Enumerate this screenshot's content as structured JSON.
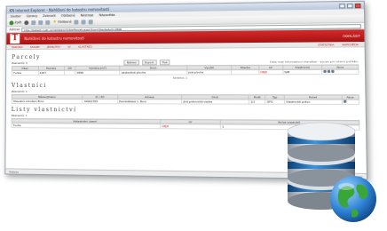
{
  "window": {
    "title": "KN Internet Explorer - Nahlížení do katastru nemovitostí"
  },
  "menu": [
    "Soubor",
    "Úpravy",
    "Zobrazit",
    "Oblíbené",
    "Nástroje",
    "Nápověda"
  ],
  "toolbar": {
    "back_label": "Zpět",
    "favorites_label": "Oblíbené"
  },
  "address": {
    "label": "Adresa",
    "url": "http://katastr.cuzk.cz/nahlizeni/VyberParcely.aspx?typ=Stavba&id=2896"
  },
  "app": {
    "logo": "T",
    "title": "Nahlížení do katastru nemovitostí",
    "right_label": "ODHLÁSIT",
    "nav": [
      "PARCELY",
      "STAVBY",
      "JEDNOTKY",
      "LV",
      "VLASTNÍCI"
    ],
    "nav_right": [
      "STATISTIKA",
      "NÁPOVĚDA"
    ]
  },
  "parcely": {
    "title": "Parcely",
    "records": "Záznamů: 1",
    "actions": [
      "Náhled",
      "Export",
      "Tisk"
    ],
    "note": "Data mají informativní charakter - pouze pro interní potřebu.",
    "columns": [
      "Obec",
      "Parcela",
      "Díl",
      "Výměra [m²]",
      "Druh",
      "Využití",
      "Stavba",
      "LV",
      "Vlastnický",
      "Akce"
    ],
    "rows": [
      [
        "Tvoka",
        "2267",
        "",
        "2896",
        "zastavěná plocha",
        "jiná plocha",
        "",
        "OBJ8",
        "SJM",
        ""
      ]
    ],
    "pager": "Stránka: 1"
  },
  "vlastnici": {
    "title": "Vlastníci",
    "records": "Záznamů: 1",
    "columns": [
      "Název/Jméno",
      "IČ / RČ",
      "Adresa",
      "Druh",
      "Podíl",
      "Typ",
      "Počet",
      "Akce"
    ],
    "rows": [
      [
        "Stavební sdružení Brno",
        "44992785",
        "Zemědělská 1, Brno",
        "jiná právnická osoba",
        "1/1",
        "OFO",
        "Vlastnické právo",
        ""
      ]
    ]
  },
  "lv": {
    "title": "Listy vlastnictví",
    "records": "Záznamů: 1",
    "columns": [
      "Katastrální území",
      "LV",
      "Počet vlastníků"
    ],
    "rows": [
      [
        "Tvoka",
        "OBJD",
        "1"
      ]
    ]
  },
  "status": {
    "left": "Hotovo",
    "right": "Data mají informativní charakter"
  },
  "colors": {
    "brand_red": "#c41818",
    "db_blue": "#1f6fb5",
    "db_silver": "#bfc5cc"
  }
}
